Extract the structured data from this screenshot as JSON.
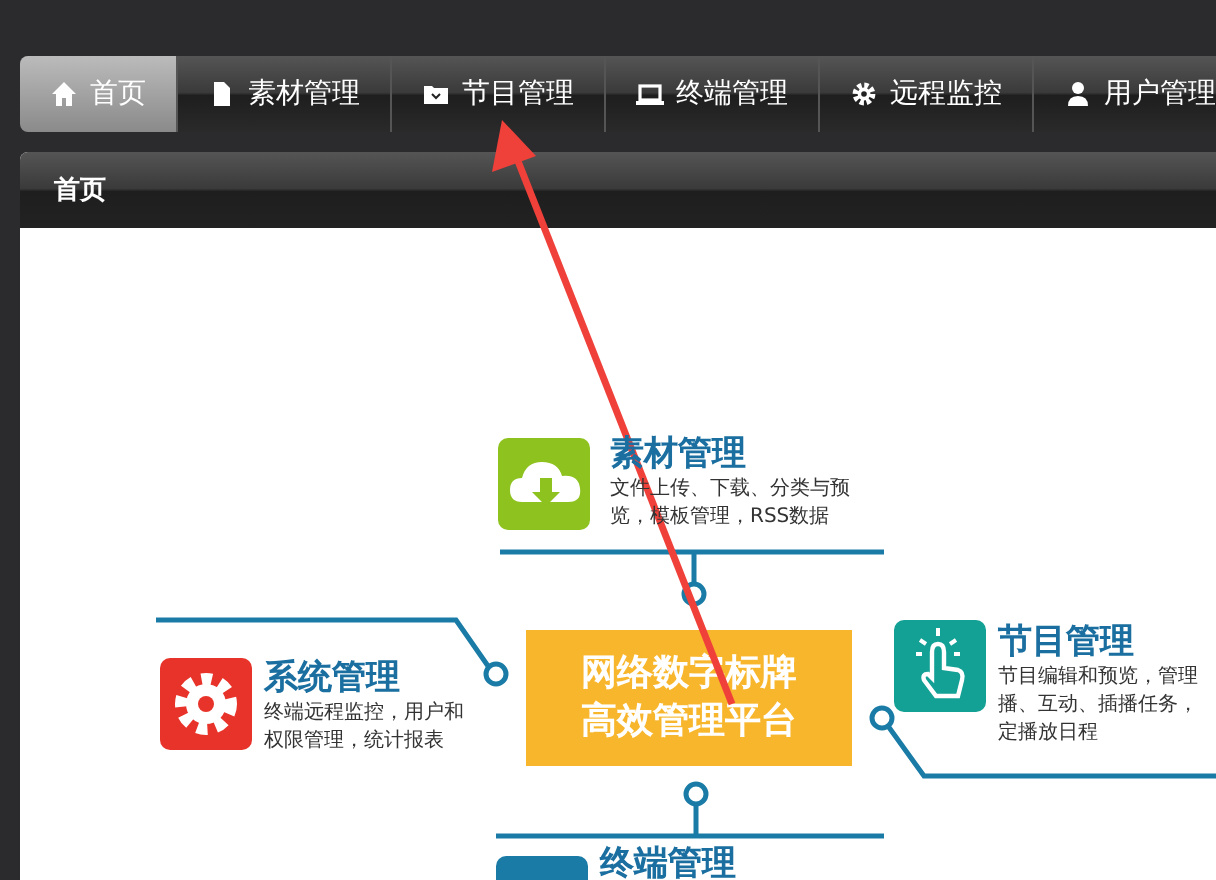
{
  "nav": {
    "tabs": [
      {
        "label": "首页",
        "kind": "home",
        "selected": true
      },
      {
        "label": "素材管理",
        "kind": "file",
        "selected": false
      },
      {
        "label": "节目管理",
        "kind": "folder",
        "selected": false
      },
      {
        "label": "终端管理",
        "kind": "laptop",
        "selected": false
      },
      {
        "label": "远程监控",
        "kind": "gear",
        "selected": false
      },
      {
        "label": "用户管理",
        "kind": "user",
        "selected": false
      }
    ]
  },
  "panel": {
    "title": "首页"
  },
  "diagram": {
    "center": [
      "网络数字标牌",
      "高效管理平台"
    ],
    "modules": [
      {
        "title": "素材管理",
        "description": [
          "文件上传、下载、分类与预",
          "览，模板管理，RSS数据"
        ],
        "color": "#8dc21f",
        "kind": "cloud"
      },
      {
        "title": "系统管理",
        "description": [
          "终端远程监控，用户和",
          "权限管理，统计报表"
        ],
        "color": "#e8332a",
        "kind": "gear"
      },
      {
        "title": "节目管理",
        "description": [
          "节目编辑和预览，管理",
          "播、互动、插播任务，",
          "定播放日程"
        ],
        "color": "#13a095",
        "kind": "hand"
      },
      {
        "title": "终端管理",
        "color": "#1a7ca6"
      }
    ]
  }
}
